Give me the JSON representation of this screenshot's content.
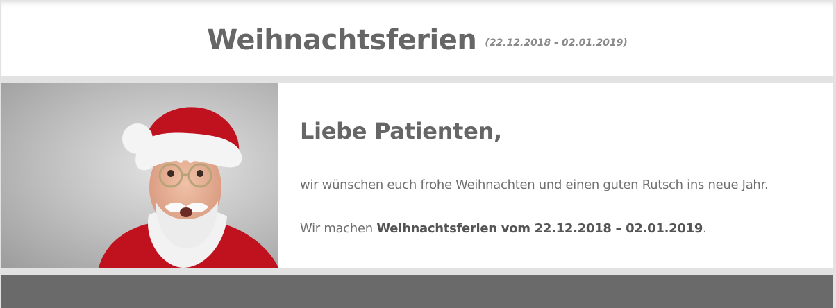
{
  "header": {
    "title": "Weihnachtsferien",
    "date_range": "(22.12.2018 - 02.01.2019)"
  },
  "image": {
    "icon": "santa-claus-photo"
  },
  "content": {
    "greeting": "Liebe Patienten,",
    "paragraph1": "wir wünschen euch frohe Weihnachten und einen guten Rutsch ins neue Jahr.",
    "paragraph2_prefix": "Wir machen ",
    "paragraph2_bold": "Weihnachtsferien vom 22.12.2018 – 02.01.2019",
    "paragraph2_suffix": "."
  },
  "colors": {
    "text": "#666666",
    "santa_red": "#c0121e",
    "footer": "#6a6a6a"
  }
}
